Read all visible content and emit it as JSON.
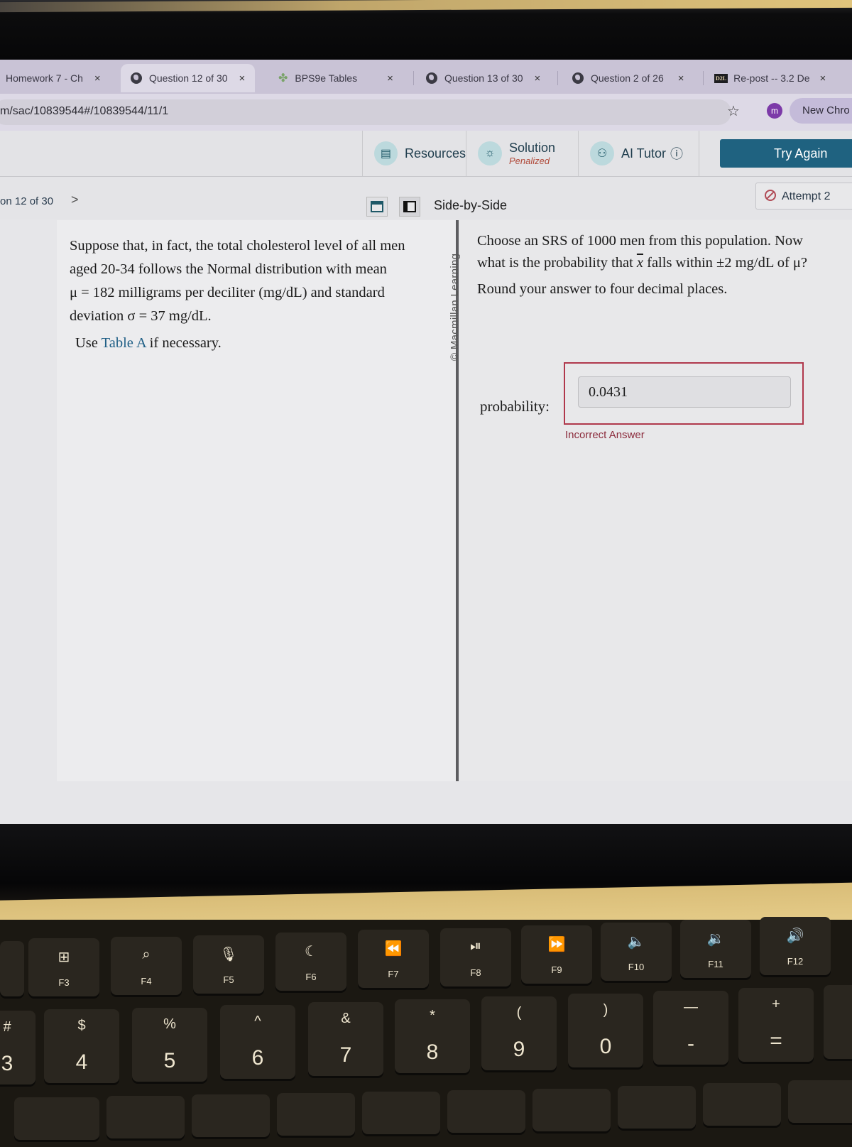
{
  "browser": {
    "tabs": [
      {
        "label": "Homework 7 - Ch",
        "icon": "none",
        "active": false
      },
      {
        "label": "Question 12 of 30",
        "icon": "globe-icon",
        "active": true
      },
      {
        "label": "BPS9e Tables",
        "icon": "leaf-icon",
        "active": false
      },
      {
        "label": "Question 13 of 30",
        "icon": "globe-icon",
        "active": false
      },
      {
        "label": "Question 2 of 26",
        "icon": "globe-icon",
        "active": false
      },
      {
        "label": "Re-post -- 3.2 De",
        "icon": "d2l-icon",
        "active": false
      }
    ],
    "close_glyph": "×",
    "d2l_badge": "D2L",
    "url": "m/sac/10839544#/10839544/11/1",
    "profile_initial": "m",
    "new_chrome_label": "New Chro"
  },
  "toolbar": {
    "resources_label": "Resources",
    "solution_label": "Solution",
    "solution_sub": "Penalized",
    "ai_tutor_label": "AI Tutor",
    "info_glyph": "ⓘ",
    "try_again_label": "Try Again"
  },
  "question_nav": {
    "position_label": "on 12 of 30",
    "next_glyph": ">",
    "view_mode_label": "Side-by-Side",
    "attempt_label": "Attempt 2"
  },
  "left_pane": {
    "stem_lines": [
      "Suppose that, in fact, the total cholesterol level of all men",
      "aged 20-34 follows the Normal distribution with mean",
      "μ = 182 milligrams per deciliter (mg/dL) and standard",
      "deviation σ = 37 mg/dL."
    ],
    "use_prefix": "Use ",
    "table_link": "Table A",
    "use_suffix": " if necessary."
  },
  "right_pane": {
    "copyright": "© Macmillan Learning",
    "q_line1": "Choose an SRS of 1000 men from this population. Now",
    "q_line2_a": "what is the probability that ",
    "q_xbar": "x",
    "q_line2_b": " falls within ±2 mg/dL of μ?",
    "round_text": "Round your answer to four decimal places.",
    "answer_label": "probability:",
    "answer_value": "0.0431",
    "feedback": "Incorrect Answer",
    "status_color": "#b0384c"
  },
  "keyboard": {
    "fn_row": [
      {
        "fn": "F3",
        "icon": "⊞"
      },
      {
        "fn": "F4",
        "icon": "⌕"
      },
      {
        "fn": "F5",
        "icon": "🎙"
      },
      {
        "fn": "F6",
        "icon": "☾"
      },
      {
        "fn": "F7",
        "icon": "⏪"
      },
      {
        "fn": "F8",
        "icon": "⏯"
      },
      {
        "fn": "F9",
        "icon": "⏩"
      },
      {
        "fn": "F10",
        "icon": "🔈"
      },
      {
        "fn": "F11",
        "icon": "🔉"
      },
      {
        "fn": "F12",
        "icon": "🔊"
      }
    ],
    "num_row": [
      {
        "top": "#",
        "bot": "3"
      },
      {
        "top": "$",
        "bot": "4"
      },
      {
        "top": "%",
        "bot": "5"
      },
      {
        "top": "^",
        "bot": "6"
      },
      {
        "top": "&",
        "bot": "7"
      },
      {
        "top": "*",
        "bot": "8"
      },
      {
        "top": "(",
        "bot": "9"
      },
      {
        "top": ")",
        "bot": "0"
      },
      {
        "top": "—",
        "bot": "-"
      },
      {
        "top": "+",
        "bot": "="
      }
    ]
  }
}
